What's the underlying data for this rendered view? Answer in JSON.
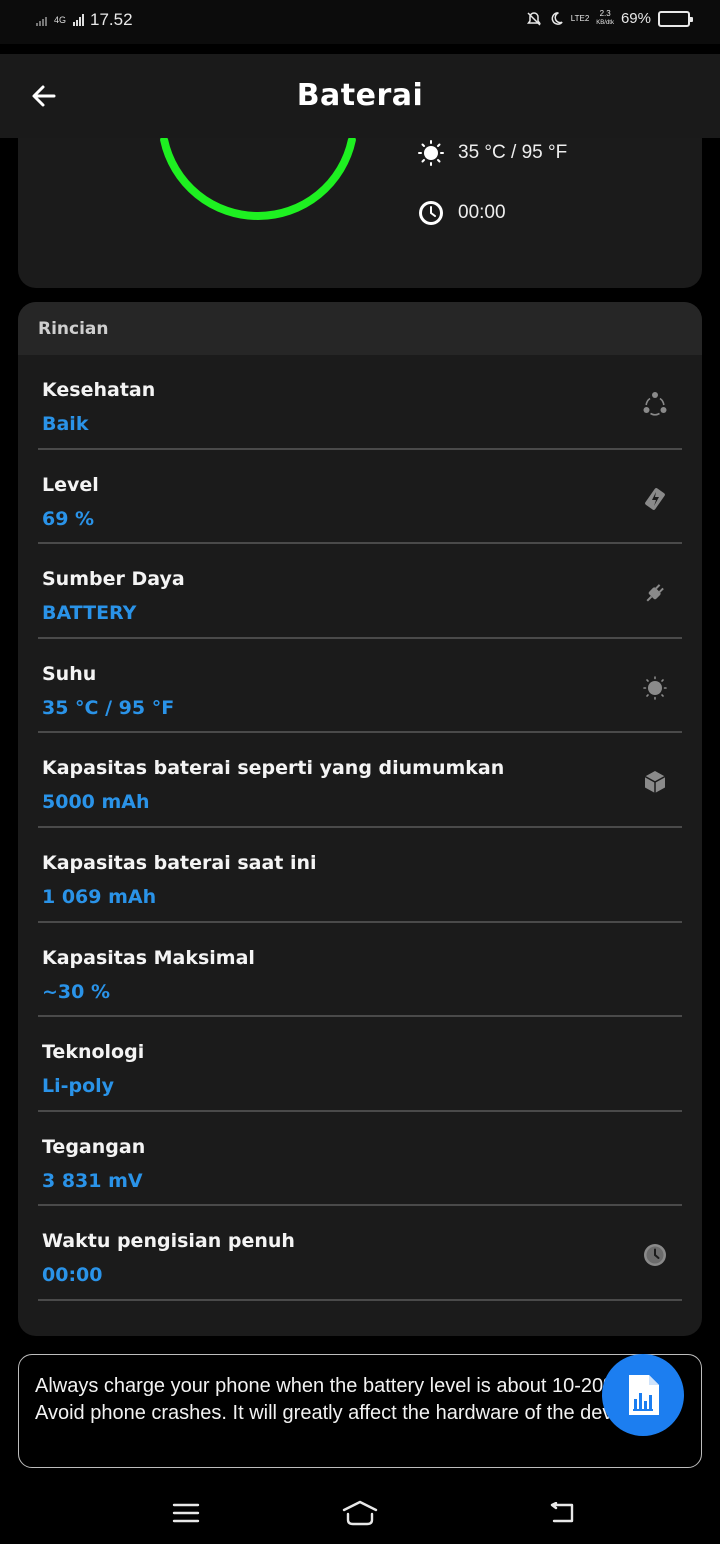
{
  "status_bar": {
    "network": "4G",
    "time": "17.52",
    "volte_label": "LTE2",
    "speed_value": "2.3",
    "speed_unit": "KB/dtk",
    "battery_percent": "69%",
    "battery_level": 0.69
  },
  "app_bar": {
    "title": "Baterai"
  },
  "summary": {
    "temperature": "35 °C / 95 °F",
    "time": "00:00",
    "gauge_color": "#1ef021",
    "gauge_level": 0.69
  },
  "details": {
    "heading": "Rincian",
    "rows": [
      {
        "label": "Kesehatan",
        "value": "Baik",
        "icon": "health-icon"
      },
      {
        "label": "Level",
        "value": "69 %",
        "icon": "battery-bolt-icon"
      },
      {
        "label": "Sumber Daya",
        "value": "BATTERY",
        "icon": "plug-icon"
      },
      {
        "label": "Suhu",
        "value": "35 °C / 95 °F",
        "icon": "sun-icon"
      },
      {
        "label": "Kapasitas baterai seperti yang diumumkan",
        "value": "5000 mAh",
        "icon": "box-icon"
      },
      {
        "label": "Kapasitas baterai saat ini",
        "value": "1 069 mAh",
        "icon": ""
      },
      {
        "label": "Kapasitas Maksimal",
        "value": "~30 %",
        "icon": ""
      },
      {
        "label": "Teknologi",
        "value": "Li-poly",
        "icon": ""
      },
      {
        "label": "Tegangan",
        "value": "3 831 mV",
        "icon": ""
      },
      {
        "label": "Waktu pengisian penuh",
        "value": "00:00",
        "icon": "clock-icon"
      }
    ]
  },
  "tip": {
    "text": "Always charge your phone when the battery level is about 10-20%. Avoid phone crashes. It will greatly affect the hardware of the device"
  },
  "colors": {
    "accent_value": "#2a93e8",
    "fab": "#1c7ef0",
    "card": "#1b1b1b"
  }
}
